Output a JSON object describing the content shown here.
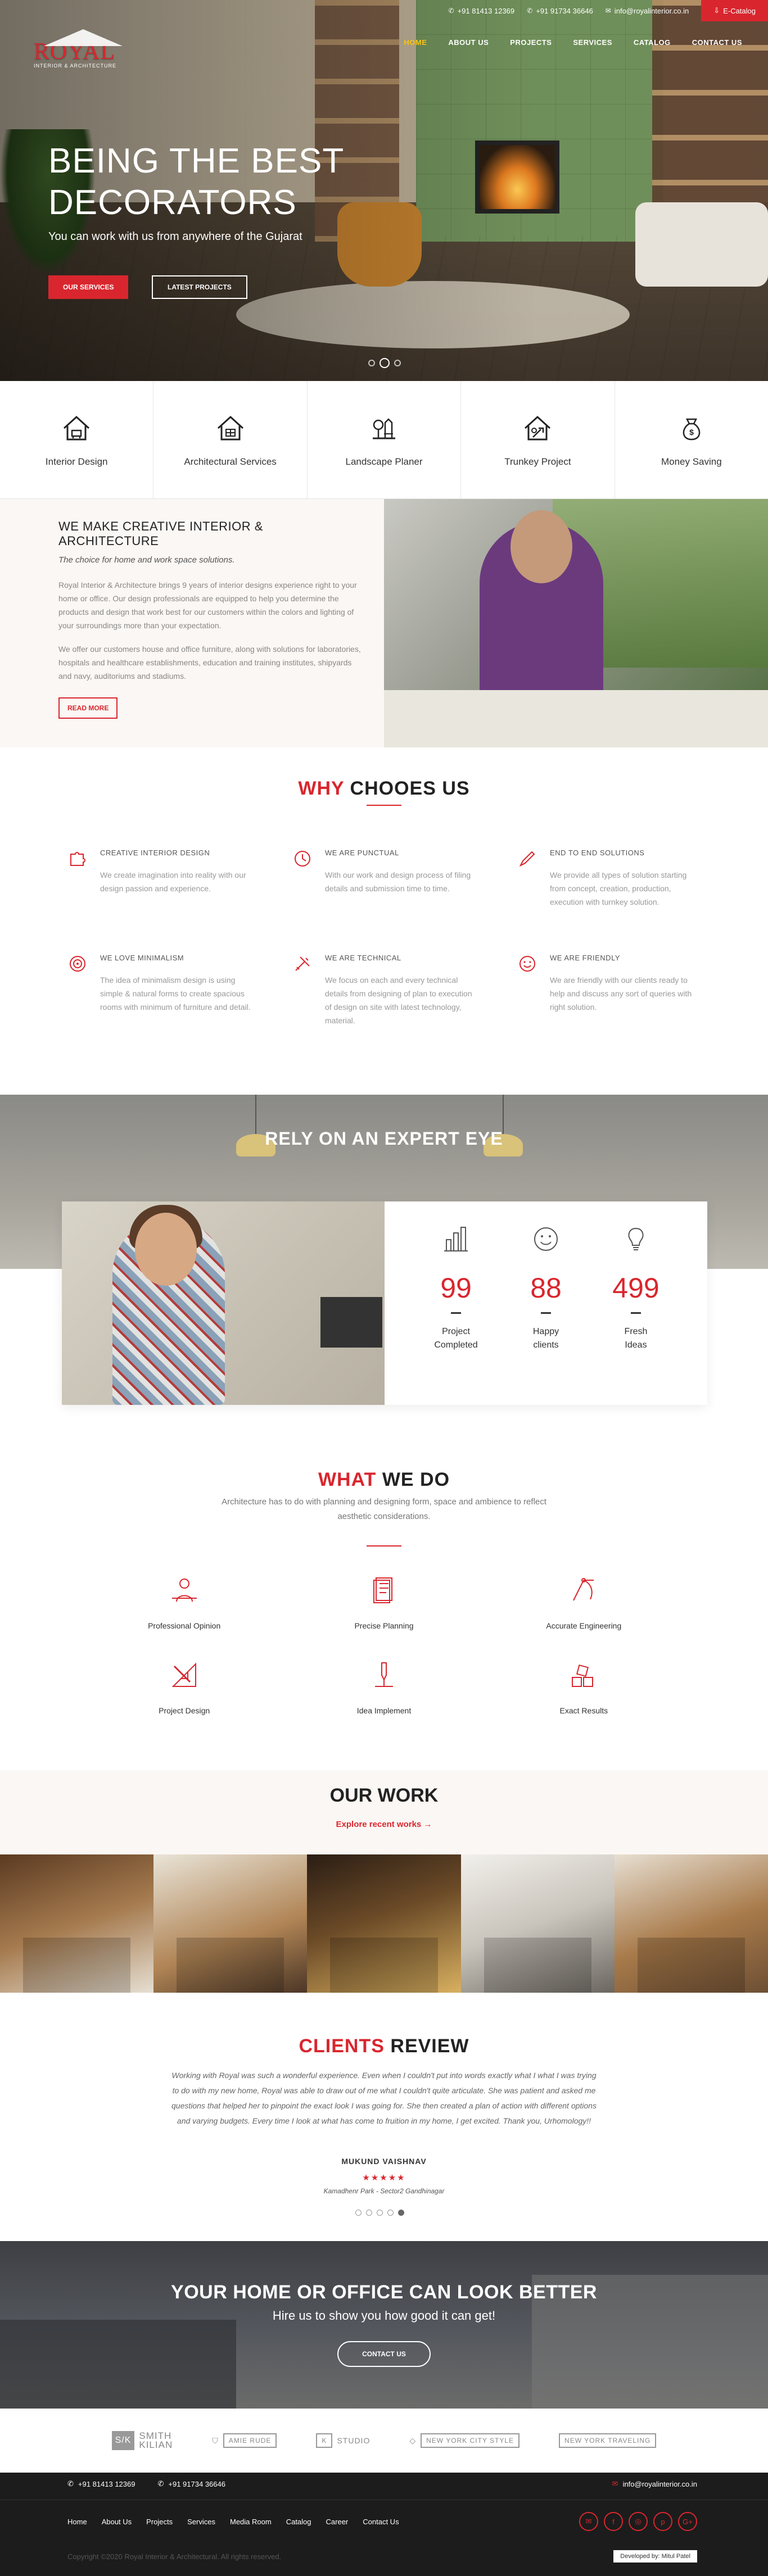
{
  "topbar": {
    "phone1": "+91 81413 12369",
    "phone2": "+91 91734 36646",
    "email": "info@royalinterior.co.in",
    "ecatalog": "E-Catalog"
  },
  "logo": {
    "name": "ROYAL",
    "sub": "INTERIOR & ARCHITECTURE"
  },
  "nav": [
    "HOME",
    "ABOUT US",
    "PROJECTS",
    "SERVICES",
    "CATALOG",
    "CONTACT US"
  ],
  "hero": {
    "title_line1": "BEING THE BEST",
    "title_line2": "DECORATORS",
    "tagline": "You can work with us from anywhere of the Gujarat",
    "btn_services": "OUR SERVICES",
    "btn_projects": "LATEST PROJECTS"
  },
  "strip": [
    {
      "label": "Interior Design",
      "icon": "house-furniture-icon"
    },
    {
      "label": "Architectural Services",
      "icon": "house-plan-icon"
    },
    {
      "label": "Landscape Planer",
      "icon": "garden-icon"
    },
    {
      "label": "Trunkey Project",
      "icon": "house-tools-icon"
    },
    {
      "label": "Money Saving",
      "icon": "money-bag-icon"
    }
  ],
  "about": {
    "heading": "WE MAKE CREATIVE INTERIOR & ARCHITECTURE",
    "lead": "The choice for home and work space solutions.",
    "p1": "Royal Interior & Architecture brings 9 years of interior designs experience right to your home or office. Our design professionals are equipped to help you determine the products and design that work best for our customers within the colors and lighting of your surroundings more than your expectation.",
    "p2": "We offer our customers house and office furniture, along with solutions for laboratories, hospitals and healthcare establishments, education and training institutes, shipyards and navy, auditoriums and stadiums.",
    "btn": "READ MORE"
  },
  "why": {
    "title_red": "WHY",
    "title_rest": " CHOOES US",
    "items": [
      {
        "title": "CREATIVE INTERIOR DESIGN",
        "text": "We create imagination into reality with our design passion and experience.",
        "icon": "puzzle-icon"
      },
      {
        "title": "WE ARE PUNCTUAL",
        "text": "With our work and design process of filing details and submission time to time.",
        "icon": "clock-icon"
      },
      {
        "title": "END TO END SOLUTIONS",
        "text": "We provide all types of solution starting from concept, creation, production, execution with turnkey solution.",
        "icon": "pen-icon"
      },
      {
        "title": "WE LOVE MINIMALISM",
        "text": "The idea of minimalism design is using simple & natural forms to create spacious rooms with minimum of furniture and detail.",
        "icon": "target-icon"
      },
      {
        "title": "WE ARE TECHNICAL",
        "text": "We focus on each and every technical details from designing of plan to execution of design on site with latest technology, material.",
        "icon": "tools-icon"
      },
      {
        "title": "WE ARE FRIENDLY",
        "text": "We are friendly with our clients ready to help and discuss any sort of queries with right solution.",
        "icon": "smile-icon"
      }
    ]
  },
  "rely": {
    "title": "RELY ON AN EXPERT EYE",
    "stats": [
      {
        "value": "99",
        "caption1": "Project",
        "caption2": "Completed",
        "icon": "bar-chart-icon"
      },
      {
        "value": "88",
        "caption1": "Happy",
        "caption2": "clients",
        "icon": "smiley-icon"
      },
      {
        "value": "499",
        "caption1": "Fresh",
        "caption2": "Ideas",
        "icon": "bulb-icon"
      }
    ]
  },
  "wwd": {
    "title_red": "WHAT",
    "title_rest": " WE DO",
    "desc": "Architecture has to do with planning and designing form, space and ambience to reflect aesthetic considerations.",
    "items": [
      {
        "label": "Professional Opinion",
        "icon": "consultant-icon"
      },
      {
        "label": "Precise Planning",
        "icon": "document-icon"
      },
      {
        "label": "Accurate Engineering",
        "icon": "compass-icon"
      },
      {
        "label": "Project Design",
        "icon": "ruler-pencil-icon"
      },
      {
        "label": "Idea Implement",
        "icon": "drill-icon"
      },
      {
        "label": "Exact Results",
        "icon": "blocks-icon"
      }
    ]
  },
  "ourwork": {
    "title": "OUR WORK",
    "link": "Explore recent works →"
  },
  "clients": {
    "title_red": "CLIENTS",
    "title_rest": " REVIEW",
    "review": "Working with Royal was such a wonderful experience. Even when I couldn't put into words exactly what I what I was trying to do with my new home, Royal was able to draw out of me what I couldn't quite articulate. She was patient and asked me questions that helped her to pinpoint the exact look I was going for. She then created a plan of action with different options and varying budgets. Every time I look at what has come to fruition in my home, I get excited. Thank you, Urhomology!!",
    "name": "MUKUND VAISHNAV",
    "stars": "★★★★★",
    "place": "Kamadhenr Park - Sector2 Gandhinagar"
  },
  "cta": {
    "title": "YOUR HOME OR OFFICE CAN LOOK BETTER",
    "sub": "Hire us to show you how good it can get!",
    "btn": "CONTACT US"
  },
  "partners": {
    "p1a": "S/K",
    "p1b": "SMITH",
    "p1c": "KILIAN",
    "p2": "AMIE RUDE",
    "p3": "STUDIO",
    "p4": "NEW YORK CITY STYLE",
    "p5": "NEW YORK TRAVELING"
  },
  "footer": {
    "phone1": "+91 81413 12369",
    "phone2": "+91 91734 36646",
    "email": "info@royalinterior.co.in",
    "links": [
      "Home",
      "About Us",
      "Projects",
      "Services",
      "Media Room",
      "Catalog",
      "Career",
      "Contact Us"
    ],
    "copyright": "Copyright ©2020 Royal Interior & Architectural. All rights reserved.",
    "developer": "Developed by: Mitul Patel"
  },
  "colors": {
    "accent": "#d9262e",
    "nav_active": "#f5c518",
    "footer_bg": "#1c1c1c"
  }
}
